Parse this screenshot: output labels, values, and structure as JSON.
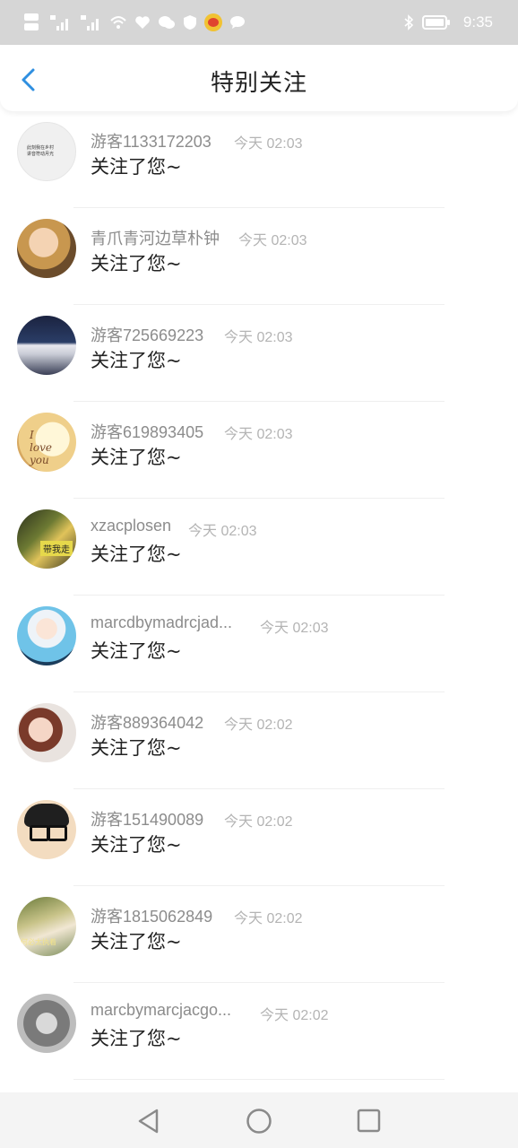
{
  "status_bar": {
    "left_icons": [
      "hd-icon",
      "signal-4g-icon",
      "signal-4g-icon",
      "wifi-icon",
      "health-icon",
      "wechat-icon",
      "shield-icon",
      "weibo-icon",
      "message-icon"
    ],
    "time": "9:35"
  },
  "header": {
    "title": "特别关注",
    "back_icon": "chevron-left-icon",
    "accent_color": "#2f8fe0"
  },
  "items": [
    {
      "name": "游客1133172203",
      "time": "今天 02:03",
      "message": "关注了您~"
    },
    {
      "name": "青爪青河边草朴钟",
      "time": "今天 02:03",
      "message": "关注了您~"
    },
    {
      "name": "游客725669223",
      "time": "今天 02:03",
      "message": "关注了您~"
    },
    {
      "name": "游客619893405",
      "time": "今天 02:03",
      "message": "关注了您~"
    },
    {
      "name": "xzacplosen",
      "time": "今天 02:03",
      "message": "关注了您~"
    },
    {
      "name": "marcdbymadrcjad...",
      "time": "今天 02:03",
      "message": "关注了您~"
    },
    {
      "name": "游客889364042",
      "time": "今天 02:02",
      "message": "关注了您~"
    },
    {
      "name": "游客151490089",
      "time": "今天 02:02",
      "message": "关注了您~"
    },
    {
      "name": "游客1815062849",
      "time": "今天 02:02",
      "message": "关注了您~"
    },
    {
      "name": "marcbymarcjacgo...",
      "time": "今天 02:02",
      "message": "关注了您~"
    }
  ],
  "nav": {
    "icons": [
      "back-triangle-icon",
      "home-circle-icon",
      "recents-square-icon"
    ]
  }
}
